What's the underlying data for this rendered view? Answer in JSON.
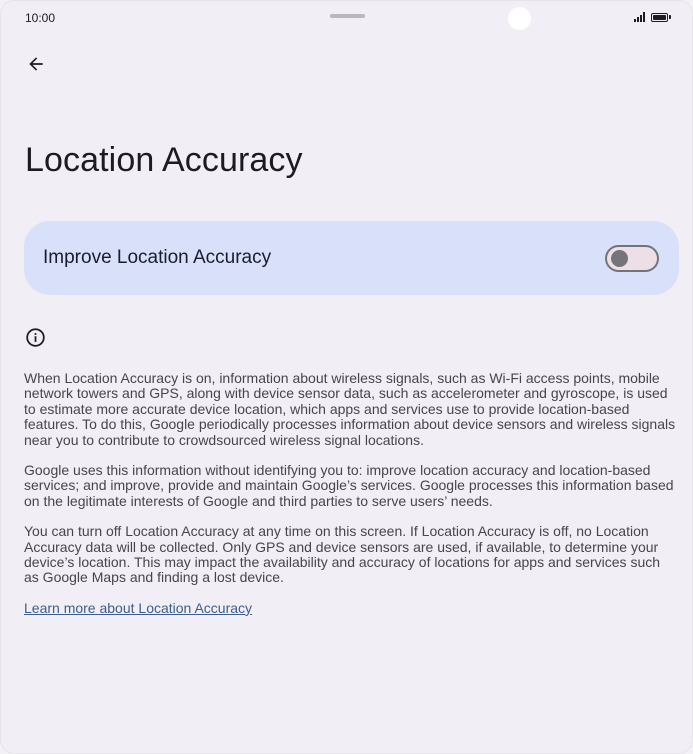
{
  "status_bar": {
    "time": "10:00"
  },
  "header": {
    "back_icon": "arrow-back-icon",
    "title": "Location Accuracy"
  },
  "toggle": {
    "label": "Improve Location Accuracy",
    "state": "off"
  },
  "info": {
    "icon": "info-icon",
    "paragraphs": [
      "When Location Accuracy is on, information about wireless signals, such as Wi-Fi access points, mobile network towers and GPS, along with device sensor data, such as accelerometer and gyroscope, is used to estimate more accurate device location, which apps and services use to provide location-based features. To do this, Google periodically processes information about device sensors and wireless signals near you to contribute to crowdsourced wireless signal locations.",
      "Google uses this information without identifying you to: improve location accuracy and location-based services; and improve, provide and maintain Google’s services. Google processes this information based on the legitimate interests of Google and third parties to serve users’ needs.",
      "You can turn off Location Accuracy at any time on this screen. If Location Accuracy is off, no Location Accuracy data will be collected. Only GPS and device sensors are used, if available, to determine your device’s location. This may impact the availability and accuracy of locations for apps and services such as Google Maps and finding a lost device."
    ],
    "learn_more_link": "Learn more about Location Accuracy"
  },
  "colors": {
    "background": "#f1eff5",
    "card": "#d8e1f9",
    "link": "#3d5d8f",
    "switch_track": "#ecdfe6",
    "switch_outline": "#75727a"
  }
}
